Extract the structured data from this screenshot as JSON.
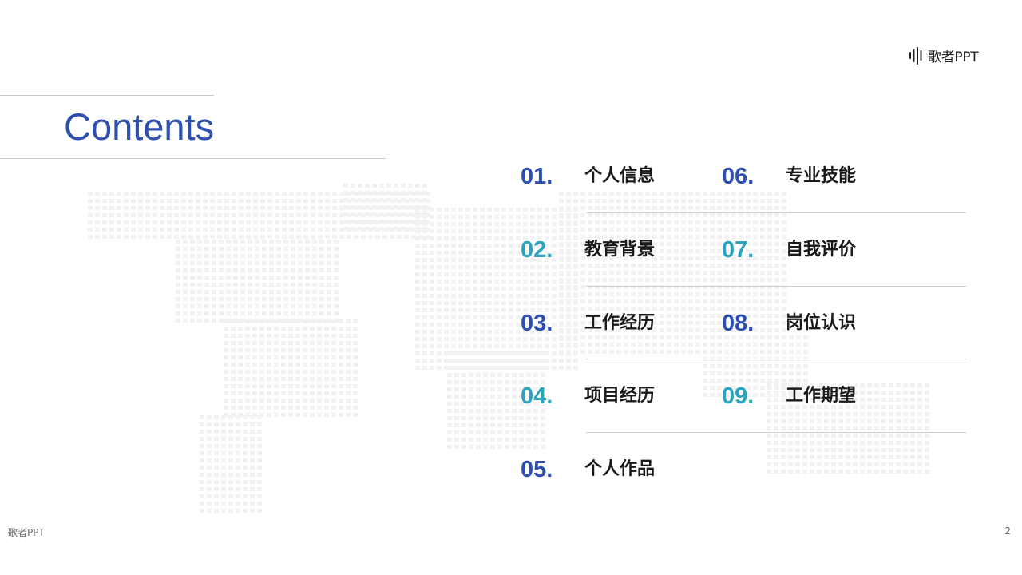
{
  "brand": {
    "logo_text": "歌者PPT"
  },
  "title": "Contents",
  "items": [
    {
      "num": "01.",
      "label": "个人信息",
      "color": "#2d4fb0"
    },
    {
      "num": "02.",
      "label": "教育背景",
      "color": "#2aa3bd"
    },
    {
      "num": "03.",
      "label": "工作经历",
      "color": "#2d4fb0"
    },
    {
      "num": "04.",
      "label": "项目经历",
      "color": "#2aa3bd"
    },
    {
      "num": "05.",
      "label": "个人作品",
      "color": "#2d4fb0"
    },
    {
      "num": "06.",
      "label": "专业技能",
      "color": "#2d4fb0"
    },
    {
      "num": "07.",
      "label": "自我评价",
      "color": "#2aa3bd"
    },
    {
      "num": "08.",
      "label": "岗位认识",
      "color": "#2d4fb0"
    },
    {
      "num": "09.",
      "label": "工作期望",
      "color": "#2aa3bd"
    }
  ],
  "footer": {
    "left_text": "歌者PPT",
    "page_number": "2"
  }
}
